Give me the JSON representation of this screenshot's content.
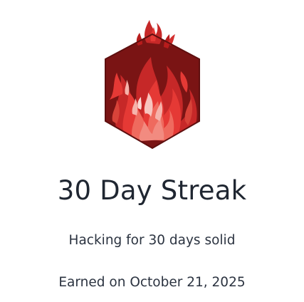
{
  "badge": {
    "icon": "flame-hexagon-icon",
    "colors": {
      "hex_dark": "#7a1414",
      "hex_mid": "#a51e1e",
      "flame_bright": "#e53935",
      "flame_light": "#ef6a5e",
      "flame_pale": "#f6b3ab"
    }
  },
  "achievement": {
    "title": "30 Day Streak",
    "description": "Hacking for 30 days solid",
    "earned": "Earned on October 21, 2025"
  }
}
